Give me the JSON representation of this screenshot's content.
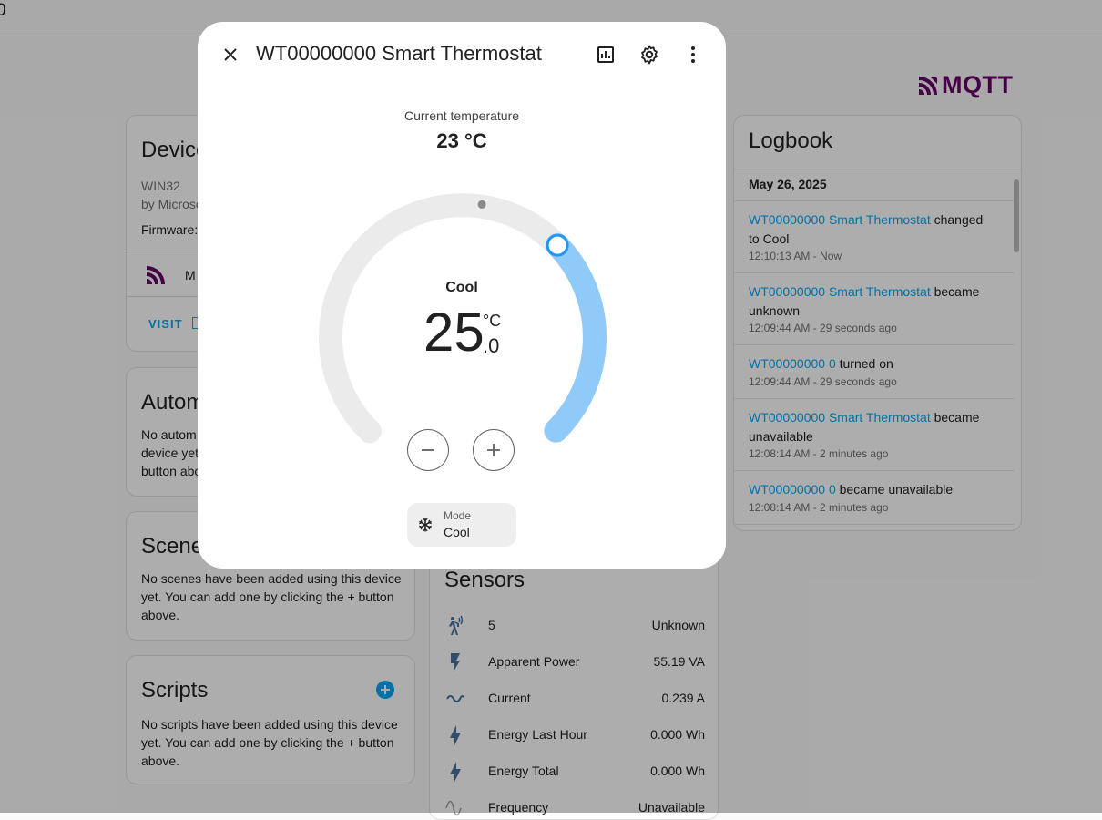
{
  "topbar": {
    "fragment": "0"
  },
  "brand": {
    "logo_text": "MQTT",
    "color": "#660066"
  },
  "device_card": {
    "title": "Device",
    "model": "WIN32",
    "manufacturer": "by Microso",
    "firmware": "Firmware:",
    "integration": "M",
    "visit_label": "VISIT"
  },
  "automations_card": {
    "title": "Autom",
    "text": [
      "No autom",
      "device yet",
      "button abo"
    ]
  },
  "scenes_card": {
    "title": "Scene",
    "text": [
      "No scenes have been added using this device",
      "yet. You can add one by clicking the + button",
      "above."
    ]
  },
  "scripts_card": {
    "title": "Scripts",
    "text": [
      "No scripts have been added using this device",
      "yet. You can add one by clicking the + button",
      "above."
    ]
  },
  "sensors_card": {
    "title": "Sensors",
    "rows": [
      {
        "icon": "motion-sensor-icon",
        "name": "5",
        "value": "Unknown"
      },
      {
        "icon": "flash-icon",
        "name": "Apparent Power",
        "value": "55.19 VA"
      },
      {
        "icon": "current-ac-icon",
        "name": "Current",
        "value": "0.239 A"
      },
      {
        "icon": "lightning-bolt-icon",
        "name": "Energy Last Hour",
        "value": "0.000 Wh"
      },
      {
        "icon": "lightning-bolt-icon",
        "name": "Energy Total",
        "value": "0.000 Wh"
      },
      {
        "icon": "sine-wave-icon",
        "name": "Frequency",
        "value": "Unavailable"
      }
    ]
  },
  "logbook": {
    "title": "Logbook",
    "date": "May 26, 2025",
    "entries": [
      {
        "entity": "WT00000000 Smart Thermostat",
        "action": " changed to Cool",
        "time": "12:10:13 AM - Now"
      },
      {
        "entity": "WT00000000 Smart Thermostat",
        "action": " became unknown",
        "time": "12:09:44 AM - 29 seconds ago"
      },
      {
        "entity": "WT00000000 0",
        "action": " turned on",
        "time": "12:09:44 AM - 29 seconds ago"
      },
      {
        "entity": "WT00000000 Smart Thermostat",
        "action": " became unavailable",
        "time": "12:08:14 AM - 2 minutes ago"
      },
      {
        "entity": "WT00000000 0",
        "action": " became unavailable",
        "time": "12:08:14 AM - 2 minutes ago"
      }
    ]
  },
  "dialog": {
    "title": "WT00000000 Smart Thermostat",
    "current_label": "Current temperature",
    "current_value": "23 °C",
    "mode_state": "Cool",
    "target_integer": "25",
    "target_unit": "°C",
    "target_decimal": ".0",
    "target_temp": 25.0,
    "dial_fill_fraction": 0.33,
    "mode_chip_label": "Mode",
    "mode_chip_value": "Cool",
    "cool_color": "#90caf9",
    "accent_color": "#2196f3"
  },
  "colors": {
    "link": "#03a9f4",
    "icon": "#44739e",
    "brand": "#660066"
  }
}
